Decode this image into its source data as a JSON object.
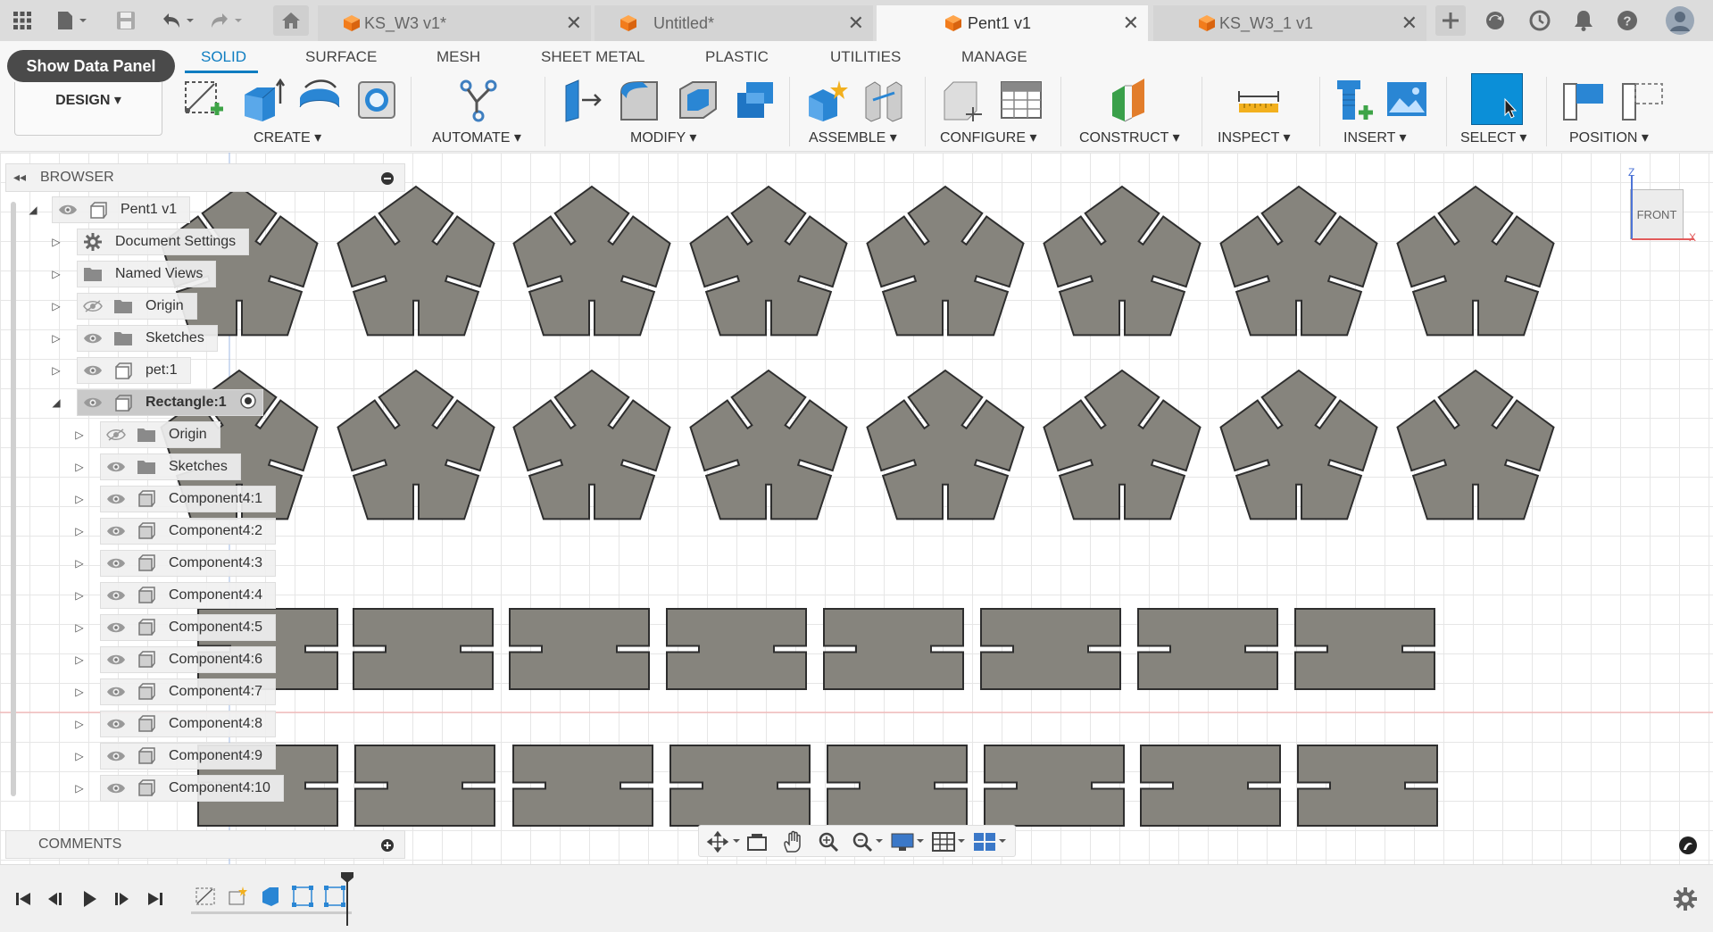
{
  "tabs": [
    {
      "label": "KS_W3 v1*",
      "active": false
    },
    {
      "label": "Untitled*",
      "active": false
    },
    {
      "label": "Pent1 v1",
      "active": true
    },
    {
      "label": "KS_W3_1 v1",
      "active": false
    }
  ],
  "ribbon": {
    "data_panel_label": "Show Data Panel",
    "design_label": "DESIGN ▾",
    "workspace_tabs": [
      "SOLID",
      "SURFACE",
      "MESH",
      "SHEET METAL",
      "PLASTIC",
      "UTILITIES",
      "MANAGE"
    ],
    "groups": [
      "CREATE ▾",
      "AUTOMATE ▾",
      "MODIFY ▾",
      "ASSEMBLE ▾",
      "CONFIGURE ▾",
      "CONSTRUCT ▾",
      "INSPECT ▾",
      "INSERT ▾",
      "SELECT ▾",
      "POSITION ▾"
    ]
  },
  "browser": {
    "title": "BROWSER",
    "nodes": [
      {
        "label": "Pent1 v1",
        "icon": "component-icon",
        "expanded": true
      },
      {
        "label": "Document Settings",
        "icon": "gear-icon"
      },
      {
        "label": "Named Views",
        "icon": "folder-icon"
      },
      {
        "label": "Origin",
        "icon": "folder-icon",
        "hidden": true
      },
      {
        "label": "Sketches",
        "icon": "folder-icon"
      },
      {
        "label": "pet:1",
        "icon": "component-icon"
      },
      {
        "label": "Rectangle:1",
        "icon": "component-icon",
        "selected": true,
        "expanded": true
      },
      {
        "label": "Origin",
        "icon": "folder-icon",
        "hidden": true
      },
      {
        "label": "Sketches",
        "icon": "folder-icon"
      },
      {
        "label": "Component4:1",
        "icon": "body-icon"
      },
      {
        "label": "Component4:2",
        "icon": "body-icon"
      },
      {
        "label": "Component4:3",
        "icon": "body-icon"
      },
      {
        "label": "Component4:4",
        "icon": "body-icon"
      },
      {
        "label": "Component4:5",
        "icon": "body-icon"
      },
      {
        "label": "Component4:6",
        "icon": "body-icon"
      },
      {
        "label": "Component4:7",
        "icon": "body-icon"
      },
      {
        "label": "Component4:8",
        "icon": "body-icon"
      },
      {
        "label": "Component4:9",
        "icon": "body-icon"
      },
      {
        "label": "Component4:10",
        "icon": "body-icon"
      }
    ]
  },
  "comments": {
    "title": "COMMENTS"
  },
  "viewcube": {
    "label": "FRONT",
    "axis_z": "Z",
    "axis_x": "X"
  },
  "colors": {
    "accent": "#0f7dc1",
    "part_fill": "#86847d",
    "part_edge": "#2e2e2e",
    "select_blue": "#0b8fd8"
  }
}
